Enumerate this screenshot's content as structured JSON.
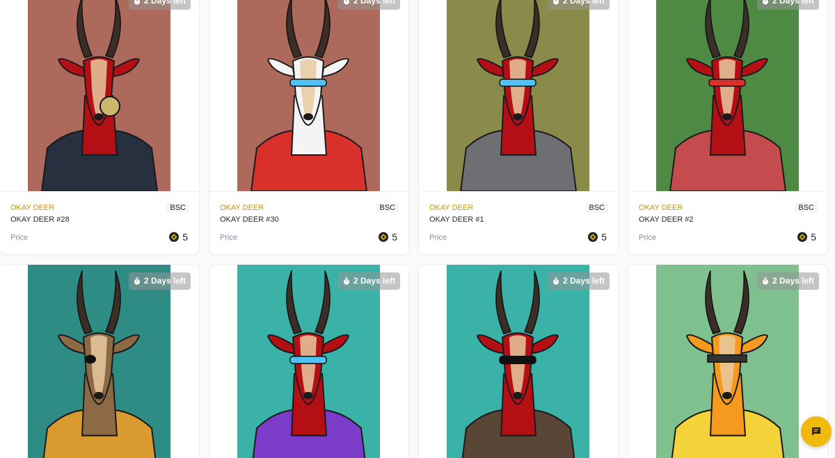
{
  "cards": [
    {
      "timer": "2 Days left",
      "collection": "OKAY DEER",
      "name": "OKAY DEER #28",
      "chain": "BSC",
      "price_label": "Price",
      "price": "5",
      "bg": "#ad6a5c",
      "head": "#b50f16",
      "body": "#26303e",
      "accessory": "gas mask"
    },
    {
      "timer": "2 Days left",
      "collection": "OKAY DEER",
      "name": "OKAY DEER #30",
      "chain": "BSC",
      "price_label": "Price",
      "price": "5",
      "bg": "#ad6a5c",
      "head": "#f4f4f4",
      "body": "#d9302c",
      "accessory": "blue glasses"
    },
    {
      "timer": "2 Days left",
      "collection": "OKAY DEER",
      "name": "OKAY DEER #1",
      "chain": "BSC",
      "price_label": "Price",
      "price": "5",
      "bg": "#8a8a4a",
      "head": "#b50f16",
      "body": "#6d6f73",
      "accessory": "visor"
    },
    {
      "timer": "2 Days left",
      "collection": "OKAY DEER",
      "name": "OKAY DEER #2",
      "chain": "BSC",
      "price_label": "Price",
      "price": "5",
      "bg": "#4e8a44",
      "head": "#b50f16",
      "body": "#c54c4e",
      "accessory": "heart glasses"
    },
    {
      "timer": "2 Days left",
      "bg": "#2f8c85",
      "head": "#8b6a45",
      "body": "#d99a30",
      "accessory": "eye patch"
    },
    {
      "timer": "2 Days left",
      "bg": "#3bb2a8",
      "head": "#b50f16",
      "body": "#7a3cc9",
      "accessory": "visor"
    },
    {
      "timer": "2 Days left",
      "bg": "#3bb2a8",
      "head": "#b50f16",
      "body": "#5a4636",
      "accessory": "sunglasses"
    },
    {
      "timer": "2 Days left",
      "bg": "#7fc08f",
      "head": "#f59a1e",
      "body": "#f4d23a",
      "accessory": "headband"
    }
  ],
  "colors": {
    "accent": "#f0b90b",
    "collection_text": "#c99400",
    "muted": "#848e9c"
  },
  "icons": {
    "timer": "stopwatch-icon",
    "coin": "bnb-coin-icon",
    "chat": "chat-icon"
  }
}
